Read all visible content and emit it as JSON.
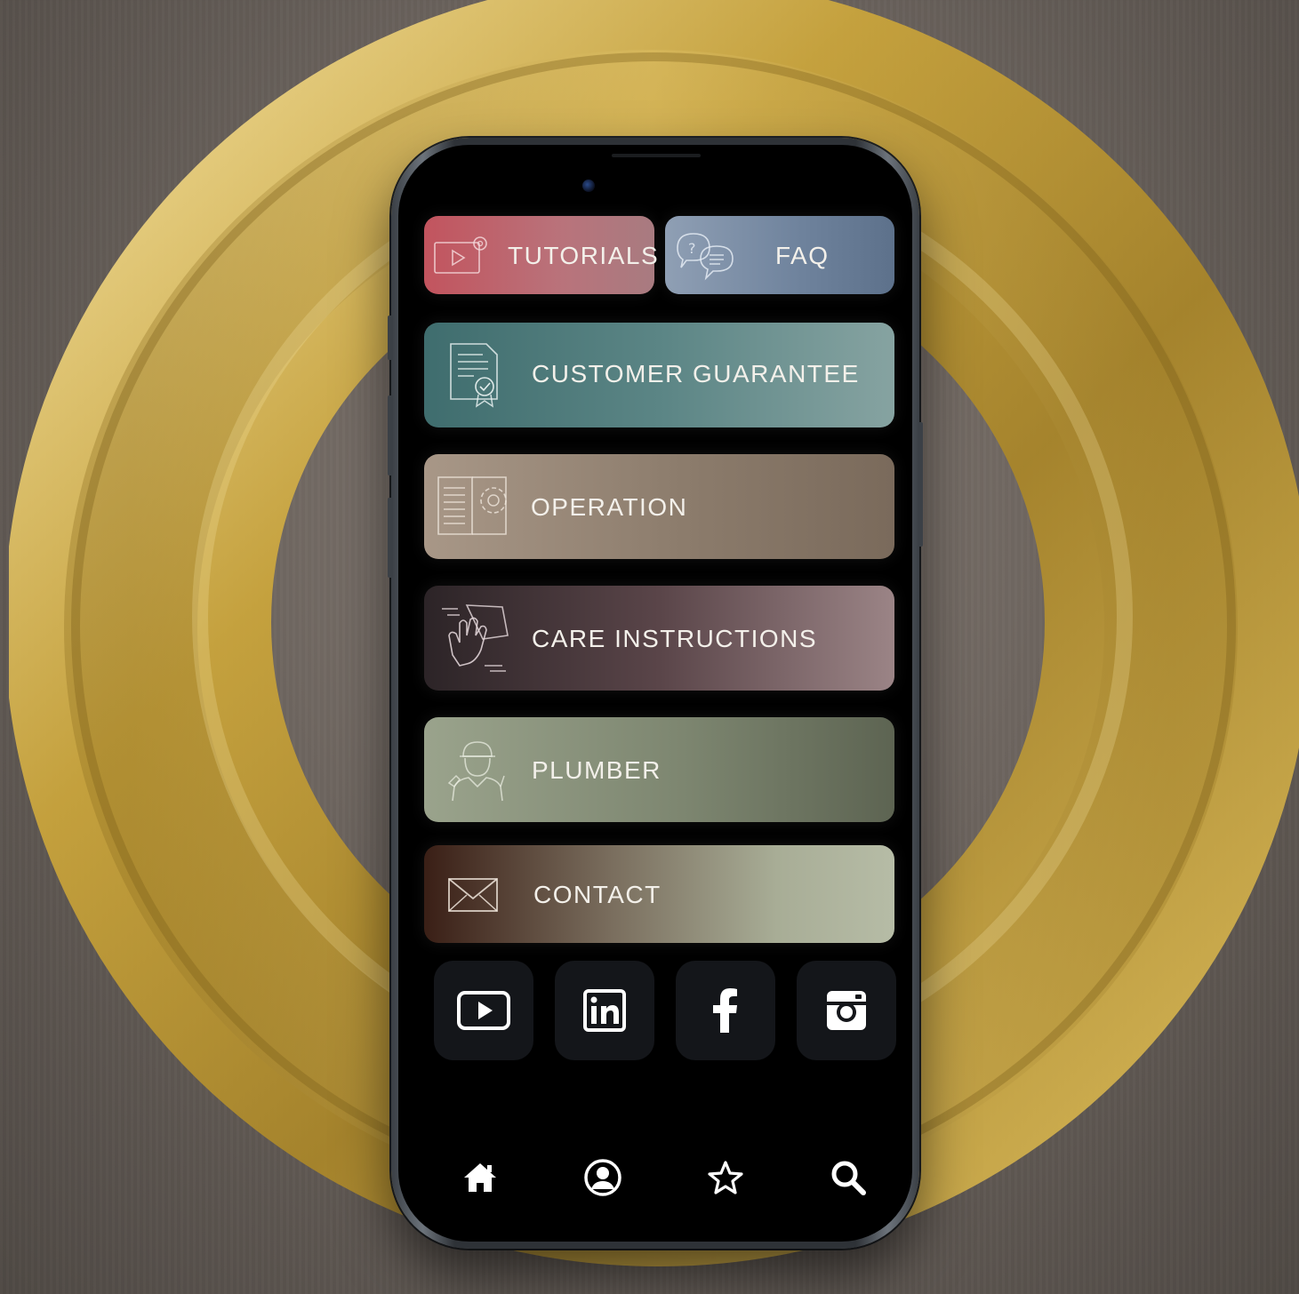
{
  "menu": {
    "tutorials_label": "TUTORIALS",
    "faq_label": "FAQ",
    "customer_guarantee_label": "CUSTOMER GUARANTEE",
    "operation_label": "OPERATION",
    "care_instructions_label": "CARE INSTRUCTIONS",
    "plumber_label": "PLUMBER",
    "contact_label": "CONTACT"
  },
  "social": [
    "youtube-icon",
    "linkedin-icon",
    "facebook-icon",
    "instagram-icon"
  ],
  "bottom_nav": [
    "home-icon",
    "profile-icon",
    "favorites-star-icon",
    "search-icon"
  ],
  "colors": {
    "tutorials": "#c2545e",
    "faq": "#6e829c",
    "customer_guarantee": "#5b8585",
    "operation": "#8c7c6c",
    "care_instructions": "#5a4549",
    "plumber": "#7d8670",
    "contact": "#a8ad96",
    "gold": "#c9a43c"
  }
}
